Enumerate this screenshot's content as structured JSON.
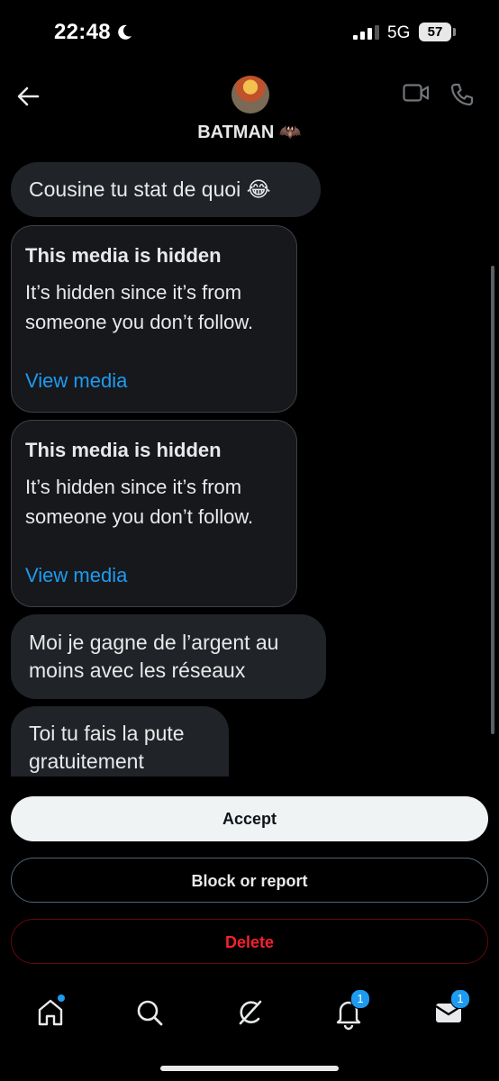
{
  "status_bar": {
    "time": "22:48",
    "network": "5G",
    "battery": "57"
  },
  "header": {
    "contact_name": "BATMAN 🦇"
  },
  "messages": [
    {
      "text": "Cousine tu stat de quoi 😂"
    },
    {
      "title": "This media is hidden",
      "description": "It’s hidden since it’s from someone you don’t follow.",
      "link": "View media"
    },
    {
      "title": "This media is hidden",
      "description": "It’s hidden since it’s from someone you don’t follow.",
      "link": "View media"
    },
    {
      "text": "Moi je gagne de l’argent au moins avec les réseaux"
    },
    {
      "text": "Toi tu fais la pute gratuitement"
    }
  ],
  "actions": {
    "accept": "Accept",
    "block": "Block or report",
    "delete": "Delete"
  },
  "tab_bar": {
    "icons": [
      "home-icon",
      "search-icon",
      "grok-icon",
      "notifications-icon",
      "messages-icon"
    ],
    "notifications_badge": "1",
    "messages_badge": "1"
  },
  "colors": {
    "accent": "#1d9bf0",
    "danger": "#f4212e",
    "bubble": "#202327",
    "background": "#000000"
  }
}
